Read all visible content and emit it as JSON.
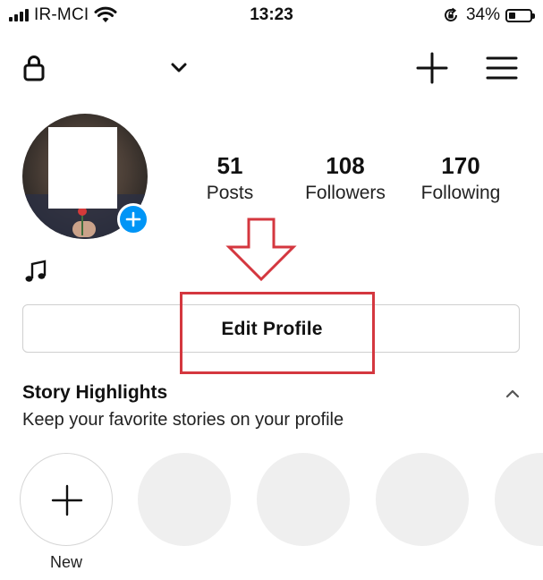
{
  "status_bar": {
    "carrier": "IR-MCI",
    "time": "13:23",
    "battery_percent_label": "34%",
    "battery_level": 0.34,
    "icons": [
      "signal-icon",
      "wifi-icon",
      "rotation-lock-icon",
      "battery-icon"
    ]
  },
  "top_nav": {
    "icons": [
      "lock-icon",
      "chevron-down-icon",
      "plus-icon",
      "hamburger-menu-icon"
    ]
  },
  "profile": {
    "stats": [
      {
        "value": "51",
        "label": "Posts"
      },
      {
        "value": "108",
        "label": "Followers"
      },
      {
        "value": "170",
        "label": "Following"
      }
    ],
    "bio_icon": "music-note-icon"
  },
  "actions": {
    "edit_profile_label": "Edit Profile"
  },
  "highlights": {
    "title": "Story Highlights",
    "subtitle": "Keep your favorite stories on your profile",
    "new_label": "New",
    "placeholder_count": 4
  },
  "colors": {
    "accent_blue": "#0095f6",
    "annotation_red": "#d4373f",
    "border_gray": "#cfcfcf",
    "placeholder_gray": "#efefef"
  }
}
